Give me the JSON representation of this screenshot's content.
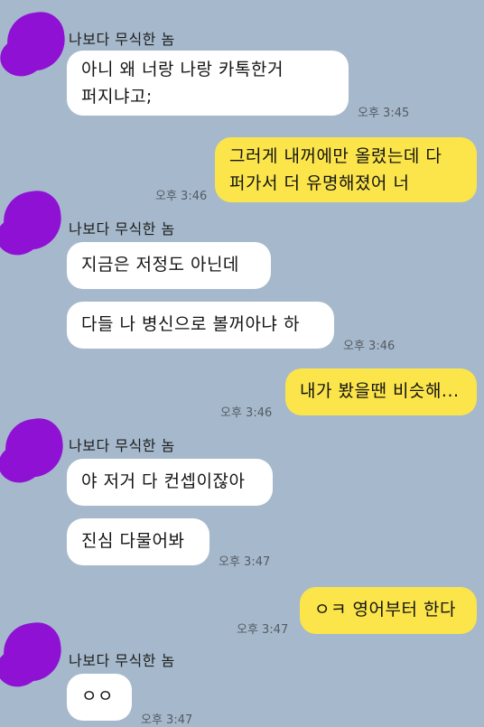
{
  "chat": {
    "messages": [
      {
        "type": "sender",
        "text": "나보다 무식한 놈"
      },
      {
        "type": "received",
        "lines": [
          "아니 왜 너랑 나랑 카톡한거",
          "퍼지냐고;"
        ],
        "time": "오후 3:45"
      },
      {
        "type": "sent",
        "lines": [
          "그러게 내꺼에만 올렸는데 다",
          "퍼가서 더 유명해졌어 너"
        ],
        "time": "오후 3:46"
      },
      {
        "type": "sender",
        "text": "나보다 무식한 놈"
      },
      {
        "type": "received",
        "lines": [
          "지금은 저정도 아닌데"
        ]
      },
      {
        "type": "received",
        "lines": [
          "다들 나 병신으로 볼꺼아냐 하"
        ],
        "time": "오후 3:46"
      },
      {
        "type": "sent",
        "lines": [
          "내가 봤을땐 비슷해..."
        ],
        "time": "오후 3:46"
      },
      {
        "type": "sender",
        "text": "나보다 무식한 놈"
      },
      {
        "type": "received",
        "lines": [
          "야 저거 다 컨셉이잖아"
        ]
      },
      {
        "type": "received",
        "lines": [
          "진심 다물어봐"
        ],
        "time": "오후 3:47"
      },
      {
        "type": "sent",
        "lines": [
          "ㅇㅋ 영어부터 한다"
        ],
        "time": "오후 3:47"
      },
      {
        "type": "sender",
        "text": "나보다 무식한 놈"
      },
      {
        "type": "received",
        "lines": [
          "ㅇㅇ"
        ],
        "time": "오후 3:47"
      }
    ]
  },
  "colors": {
    "background": "#a6b9cc",
    "sent_bubble": "#fbe54b",
    "received_bubble": "#ffffff",
    "avatar": "#8f12d4"
  }
}
